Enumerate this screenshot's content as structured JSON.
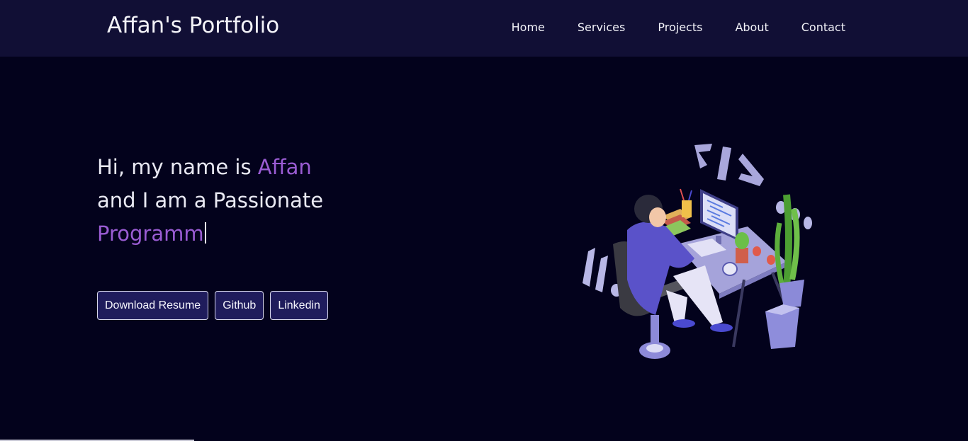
{
  "header": {
    "brand": "Affan's Portfolio",
    "nav": [
      "Home",
      "Services",
      "Projects",
      "About",
      "Contact"
    ]
  },
  "hero": {
    "line1_prefix": "Hi, my name is ",
    "name": "Affan",
    "line2": "and I am a Passionate",
    "typed_text": "Programm"
  },
  "buttons": {
    "resume": "Download Resume",
    "github": "Github",
    "linkedin": "Linkedin"
  },
  "colors": {
    "background": "#03021c",
    "navbar": "#110f35",
    "accent": "#9a5cd3",
    "button_bg": "#1f1c5c"
  }
}
